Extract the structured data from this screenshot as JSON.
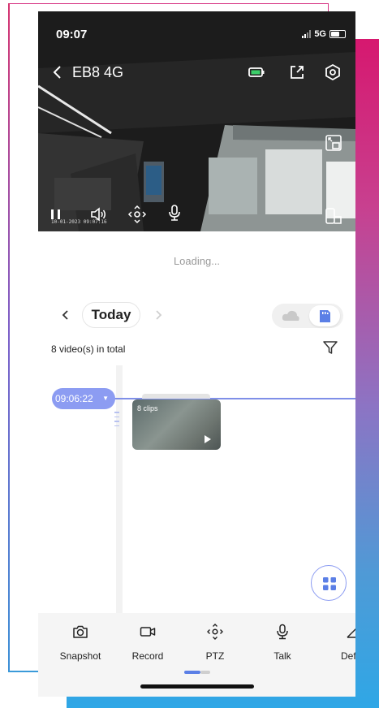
{
  "status_bar": {
    "time": "09:07",
    "network": "5G"
  },
  "header": {
    "back_icon": "chevron-left-icon",
    "device_name": "EB8 4G"
  },
  "video": {
    "timestamp": "10-01-2023 09:07:16"
  },
  "loading_text": "Loading...",
  "date_nav": {
    "label": "Today"
  },
  "storage": {
    "options": [
      "cloud",
      "sd-card"
    ],
    "selected": "sd-card"
  },
  "recordings": {
    "count_text": "8 video(s) in total"
  },
  "timeline": {
    "time": "09:06:22",
    "clip_label": "8 clips"
  },
  "toolbar": {
    "items": [
      {
        "label": "Snapshot",
        "icon": "camera-icon"
      },
      {
        "label": "Record",
        "icon": "video-record-icon"
      },
      {
        "label": "PTZ",
        "icon": "ptz-icon"
      },
      {
        "label": "Talk",
        "icon": "microphone-icon"
      },
      {
        "label": "Defin",
        "icon": "definition-icon"
      }
    ]
  },
  "colors": {
    "accent": "#8c9cf2",
    "battery": "#3ccf6a"
  }
}
